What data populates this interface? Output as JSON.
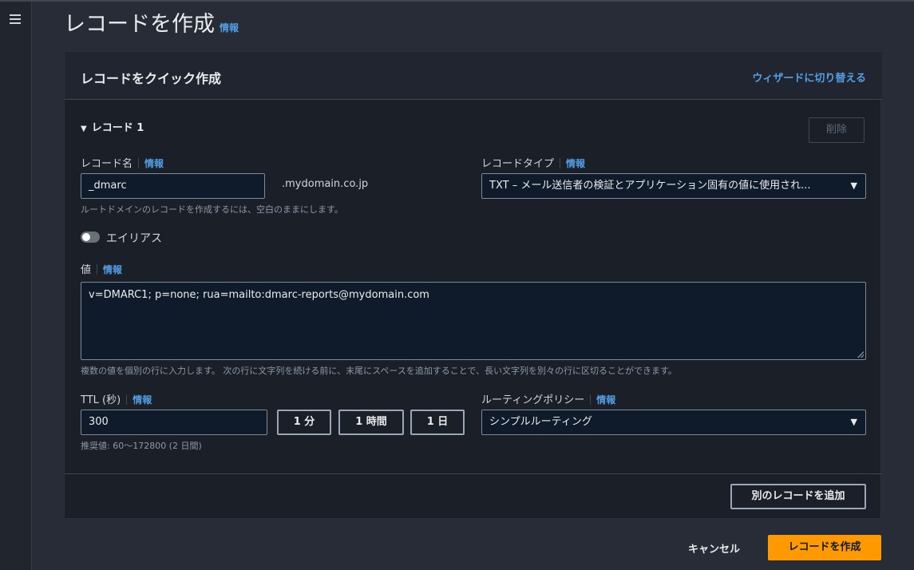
{
  "page": {
    "title": "レコードを作成",
    "info": "情報"
  },
  "panel": {
    "title": "レコードをクイック作成",
    "wizard_link": "ウィザードに切り替える"
  },
  "record": {
    "section_label": "レコード 1",
    "delete_label": "削除",
    "name_label": "レコード名",
    "name_info": "情報",
    "name_value": "_dmarc",
    "domain_suffix": ".mydomain.co.jp",
    "name_hint": "ルートドメインのレコードを作成するには、空白のままにします。",
    "type_label": "レコードタイプ",
    "type_info": "情報",
    "type_value": "TXT – メール送信者の検証とアプリケーション固有の値に使用され...",
    "alias_label": "エイリアス",
    "alias_enabled": false,
    "value_label": "値",
    "value_info": "情報",
    "value_text": "v=DMARC1; p=none; rua=mailto:dmarc-reports@mydomain.com",
    "value_hint": "複数の値を個別の行に入力します。 次の行に文字列を続ける前に、末尾にスペースを追加することで、長い文字列を別々の行に区切ることができます。",
    "ttl_label": "TTL (秒)",
    "ttl_info": "情報",
    "ttl_value": "300",
    "ttl_presets": [
      "1 分",
      "1 時間",
      "1 日"
    ],
    "ttl_hint": "推奨値: 60～172800 (2 日間)",
    "routing_label": "ルーティングポリシー",
    "routing_info": "情報",
    "routing_value": "シンプルルーティング"
  },
  "footer": {
    "add_record": "別のレコードを追加",
    "cancel": "キャンセル",
    "create": "レコードを作成"
  },
  "icons": {
    "menu": "menu-icon",
    "caret": "caret-down-icon",
    "triangle": "triangle-down-icon"
  },
  "colors": {
    "accent": "#539fe5",
    "primary": "#ff9900",
    "background": "#272c37",
    "panel": "#1b1f28"
  }
}
